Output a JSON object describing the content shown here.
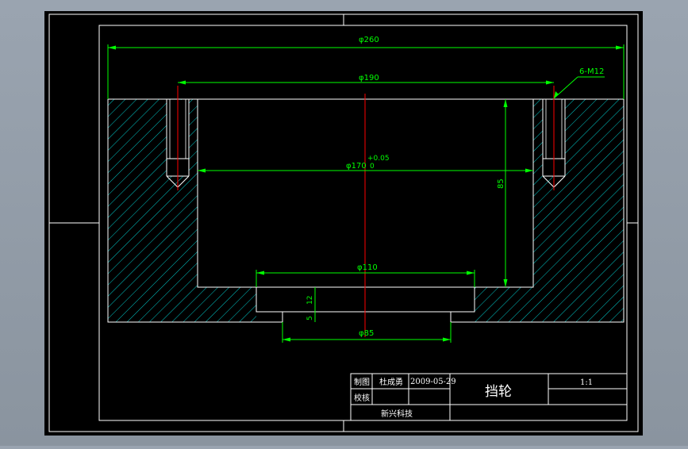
{
  "drawing": {
    "dimensions": {
      "overall_diameter": "φ260",
      "bolt_circle_diameter": "φ190",
      "thread_callout": "6-M12",
      "bore_diameter": "φ170",
      "bore_tolerance_upper": "+0.05",
      "bore_tolerance_lower": "0",
      "bore_depth": "85",
      "step_diameter": "φ110",
      "step_height": "12",
      "bottom_height": "5",
      "bottom_diameter": "φ85"
    },
    "title_block": {
      "drawn_label": "制图",
      "drawn_by": "杜成勇",
      "date": "2009-05-29",
      "check_label": "校核",
      "part_name": "挡轮",
      "scale": "1:1",
      "company": "新兴科技"
    },
    "colors": {
      "background": "#000000",
      "outline": "#ffffff",
      "dimension": "#00ff00",
      "hatch": "#00c8c8",
      "centerline": "#ff0000"
    }
  }
}
